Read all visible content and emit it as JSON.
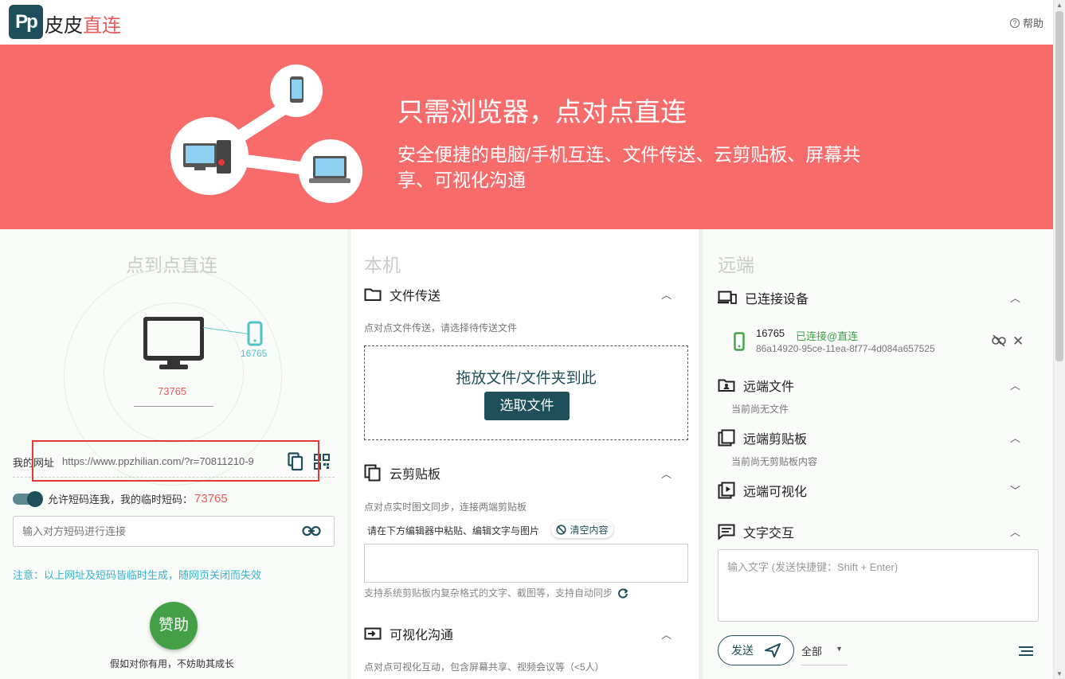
{
  "header": {
    "logo_mark": "Pp",
    "brand_name_part1": "皮皮",
    "brand_name_part2": "直连",
    "help_label": "帮助"
  },
  "hero": {
    "title": "只需浏览器，点对点直连",
    "subtitle": "安全便捷的电脑/手机互连、文件传送、云剪贴板、屏幕共享、可视化沟通"
  },
  "left": {
    "heading": "点到点直连",
    "peer_code": "16765",
    "my_code": "73765",
    "url_label": "我的网址",
    "url_value": "https://www.ppzhilian.com/?r=70811210-9",
    "toggle_label": "允许短码连我，我的临时短码：",
    "toggle_code": "73765",
    "toggle_on": true,
    "connect_placeholder": "输入对方短码进行连接",
    "notice": "注意：以上网址及短码皆临时生成，随网页关闭而失效",
    "sponsor_label": "赞助",
    "sponsor_note": "假如对你有用，不妨助其成长"
  },
  "mid": {
    "heading": "本机",
    "file": {
      "title": "文件传送",
      "desc": "点对点文件传送，请选择待传送文件",
      "drop_text": "拖放文件/文件夹到此",
      "pick_button": "选取文件"
    },
    "clipboard": {
      "title": "云剪贴板",
      "desc": "点对点实时图文同步，连接两端剪贴板",
      "paste_hint": "请在下方编辑器中粘贴、编辑文字与图片",
      "clear_button": "清空内容",
      "support_note": "支持系统剪贴板内复杂格式的文字、截图等，支持自动同步"
    },
    "visual": {
      "title": "可视化沟通",
      "desc": "点对点可视化互动，包含屏幕共享、视频会议等（<5人）"
    }
  },
  "right": {
    "heading": "远端",
    "devices_title": "已连接设备",
    "device": {
      "name": "16765",
      "status": "已连接@直连",
      "id": "86a14920-95ce-11ea-8f77-4d084a657525"
    },
    "files_title": "远端文件",
    "files_empty": "当前尚无文件",
    "clipboard_title": "远端剪贴板",
    "clipboard_empty": "当前尚无剪贴板内容",
    "visual_title": "远端可视化",
    "text_title": "文字交互",
    "text_placeholder": "输入文字 (发送快捷键：Shift + Enter)",
    "send_label": "发送",
    "target_value": "全部"
  },
  "colors": {
    "brand": "#1e4f5a",
    "hero_bg": "#f76b6b",
    "accent_red": "#e85a5a",
    "success_green": "#43a047",
    "notice_cyan": "#3ab3c9"
  }
}
